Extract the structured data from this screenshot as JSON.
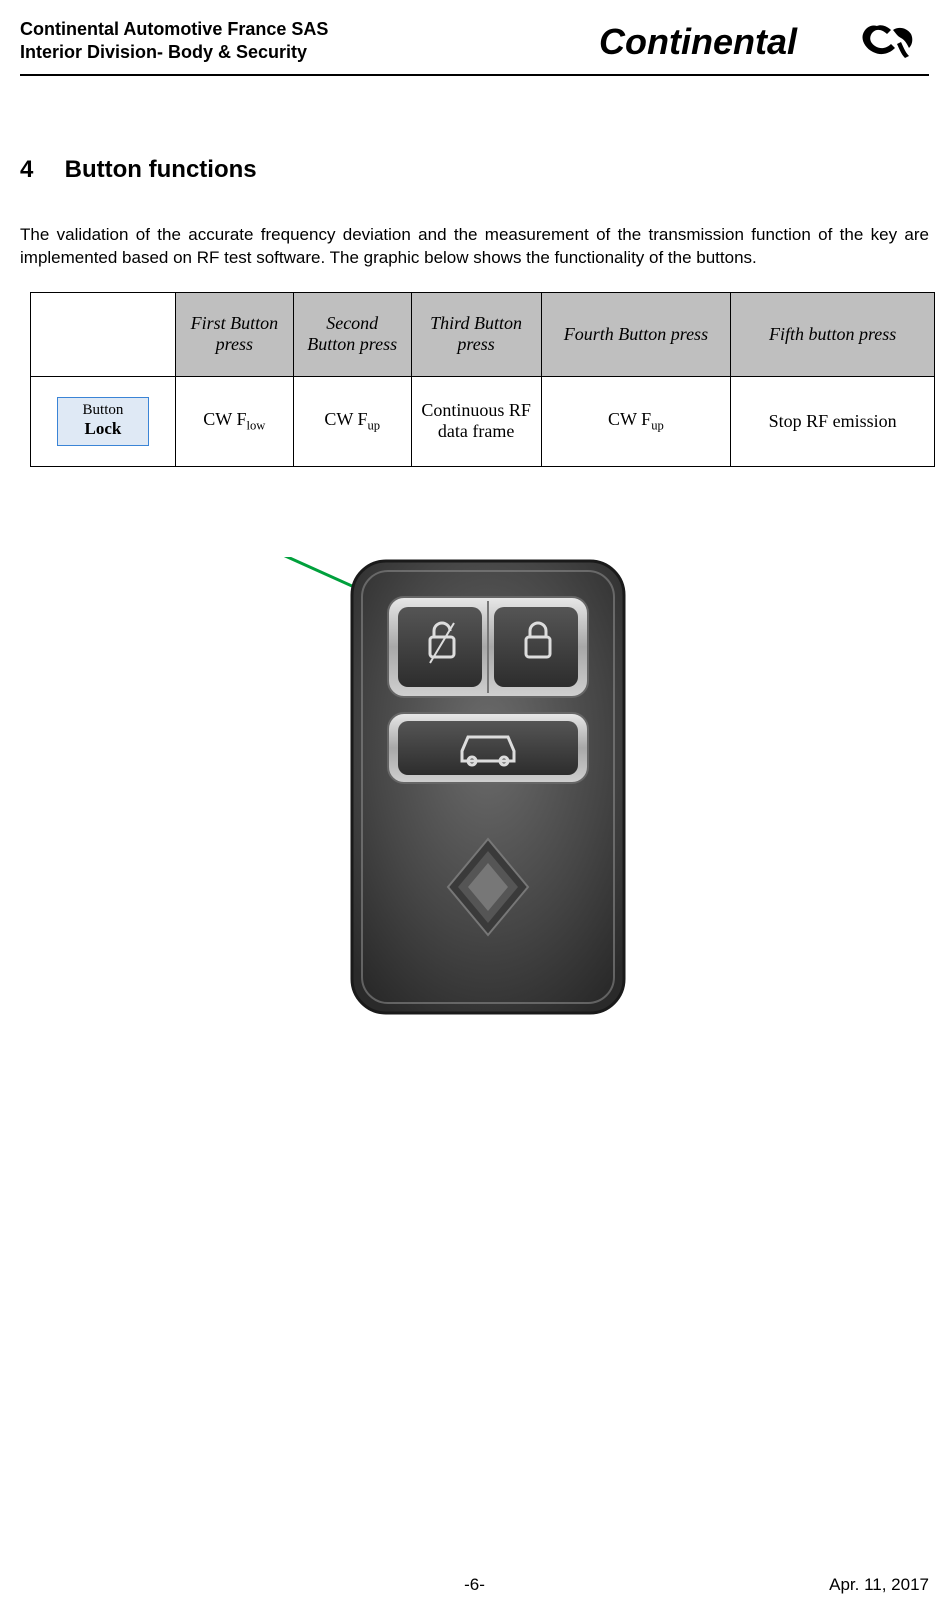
{
  "header": {
    "line1": "Continental Automotive France SAS",
    "line2": "Interior Division- Body & Security",
    "logo_text": "Continental"
  },
  "section": {
    "number": "4",
    "title": "Button functions"
  },
  "intro": "The validation of the accurate frequency deviation and the measurement of the transmission function of the key are implemented based on RF test software. The graphic below shows the functionality of the buttons.",
  "table": {
    "headers": [
      "",
      "First Button press",
      "Second Button press",
      "Third Button press",
      "Fourth Button press",
      "Fifth button press"
    ],
    "row_label": {
      "small": "Button",
      "bold": "Lock"
    },
    "row_values": {
      "c1_pre": "CW F",
      "c1_sub": "low",
      "c2_pre": "CW F",
      "c2_sub": "up",
      "c3": "Continuous RF data frame",
      "c4_pre": "CW F",
      "c4_sub": "up",
      "c5": "Stop RF emission"
    }
  },
  "keycard": {
    "icon_unlock": "unlock-icon",
    "icon_lock": "lock-icon",
    "icon_car": "car-icon"
  },
  "footer": {
    "page": "-6-",
    "date": "Apr. 11, 2017"
  }
}
